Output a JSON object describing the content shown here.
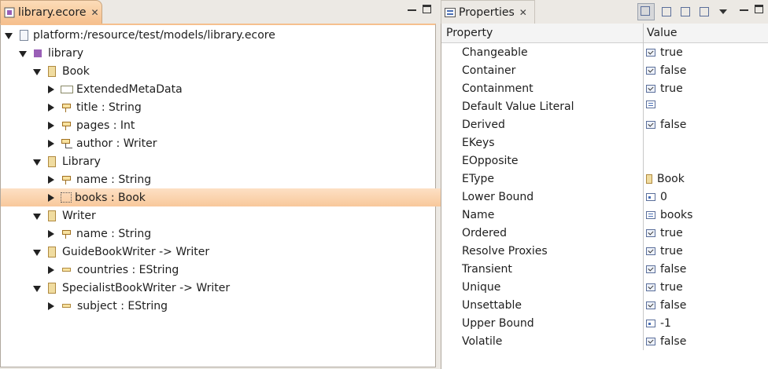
{
  "editor": {
    "tab_title": "library.ecore",
    "close_glyph": "✕",
    "tree": [
      {
        "label": "platform:/resource/test/models/library.ecore",
        "icon": "file-icon",
        "depth": 0,
        "expanded": true
      },
      {
        "label": "library",
        "icon": "package-icon",
        "depth": 1,
        "expanded": true
      },
      {
        "label": "Book",
        "icon": "class-icon",
        "depth": 2,
        "expanded": true
      },
      {
        "label": "ExtendedMetaData",
        "icon": "annotation-icon",
        "depth": 3,
        "expanded": false
      },
      {
        "label": "title : String",
        "icon": "attribute-icon",
        "depth": 3,
        "expanded": false
      },
      {
        "label": "pages : Int",
        "icon": "attribute-icon",
        "depth": 3,
        "expanded": false
      },
      {
        "label": "author : Writer",
        "icon": "reference-icon",
        "depth": 3,
        "expanded": false
      },
      {
        "label": "Library",
        "icon": "class-icon",
        "depth": 2,
        "expanded": true
      },
      {
        "label": "name : String",
        "icon": "attribute-icon",
        "depth": 3,
        "expanded": false
      },
      {
        "label": "books : Book",
        "icon": "containment-reference-icon",
        "depth": 3,
        "expanded": false,
        "selected": true
      },
      {
        "label": "Writer",
        "icon": "class-icon",
        "depth": 2,
        "expanded": true
      },
      {
        "label": "name : String",
        "icon": "attribute-icon",
        "depth": 3,
        "expanded": false
      },
      {
        "label": "GuideBookWriter -> Writer",
        "icon": "class-icon",
        "depth": 2,
        "expanded": true
      },
      {
        "label": "countries : EString",
        "icon": "eattribute-icon",
        "depth": 3,
        "expanded": false
      },
      {
        "label": "SpecialistBookWriter -> Writer",
        "icon": "class-icon",
        "depth": 2,
        "expanded": true
      },
      {
        "label": "subject : EString",
        "icon": "eattribute-icon",
        "depth": 3,
        "expanded": false
      }
    ]
  },
  "properties": {
    "tab_title": "Properties",
    "close_glyph": "✕",
    "col_property": "Property",
    "col_value": "Value",
    "rows": [
      {
        "name": "Changeable",
        "value": "true",
        "icon": "bool"
      },
      {
        "name": "Container",
        "value": "false",
        "icon": "bool"
      },
      {
        "name": "Containment",
        "value": "true",
        "icon": "bool"
      },
      {
        "name": "Default Value Literal",
        "value": "",
        "icon": "text"
      },
      {
        "name": "Derived",
        "value": "false",
        "icon": "bool"
      },
      {
        "name": "EKeys",
        "value": "",
        "icon": ""
      },
      {
        "name": "EOpposite",
        "value": "",
        "icon": ""
      },
      {
        "name": "EType",
        "value": "Book",
        "icon": "class"
      },
      {
        "name": "Lower Bound",
        "value": "0",
        "icon": "num"
      },
      {
        "name": "Name",
        "value": "books",
        "icon": "text"
      },
      {
        "name": "Ordered",
        "value": "true",
        "icon": "bool"
      },
      {
        "name": "Resolve Proxies",
        "value": "true",
        "icon": "bool"
      },
      {
        "name": "Transient",
        "value": "false",
        "icon": "bool"
      },
      {
        "name": "Unique",
        "value": "true",
        "icon": "bool"
      },
      {
        "name": "Unsettable",
        "value": "false",
        "icon": "bool"
      },
      {
        "name": "Upper Bound",
        "value": "-1",
        "icon": "num"
      },
      {
        "name": "Volatile",
        "value": "false",
        "icon": "bool"
      }
    ]
  }
}
